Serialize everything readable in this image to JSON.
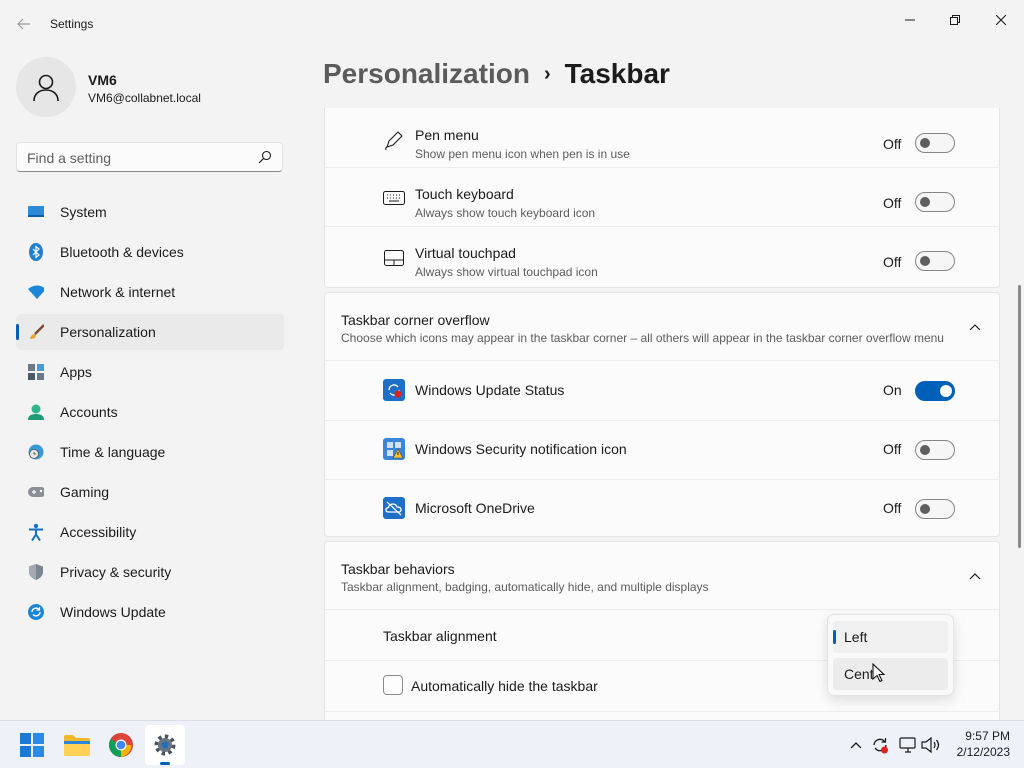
{
  "window": {
    "title": "Settings"
  },
  "user": {
    "name": "VM6",
    "email": "VM6@collabnet.local"
  },
  "search": {
    "placeholder": "Find a setting"
  },
  "sidebar": {
    "items": [
      {
        "label": "System",
        "icon": "system-icon"
      },
      {
        "label": "Bluetooth & devices",
        "icon": "bluetooth-icon"
      },
      {
        "label": "Network & internet",
        "icon": "wifi-icon"
      },
      {
        "label": "Personalization",
        "icon": "brush-icon",
        "active": true
      },
      {
        "label": "Apps",
        "icon": "apps-icon"
      },
      {
        "label": "Accounts",
        "icon": "accounts-icon"
      },
      {
        "label": "Time & language",
        "icon": "clock-globe-icon"
      },
      {
        "label": "Gaming",
        "icon": "gamepad-icon"
      },
      {
        "label": "Accessibility",
        "icon": "accessibility-icon"
      },
      {
        "label": "Privacy & security",
        "icon": "shield-icon"
      },
      {
        "label": "Windows Update",
        "icon": "update-icon"
      }
    ]
  },
  "breadcrumb": {
    "parent": "Personalization",
    "separator": "›",
    "current": "Taskbar"
  },
  "corner_icons": [
    {
      "title": "Pen menu",
      "subtitle": "Show pen menu icon when pen is in use",
      "state": "Off",
      "on": false,
      "icon": "pen-icon"
    },
    {
      "title": "Touch keyboard",
      "subtitle": "Always show touch keyboard icon",
      "state": "Off",
      "on": false,
      "icon": "keyboard-icon"
    },
    {
      "title": "Virtual touchpad",
      "subtitle": "Always show virtual touchpad icon",
      "state": "Off",
      "on": false,
      "icon": "touchpad-icon"
    }
  ],
  "overflow": {
    "title": "Taskbar corner overflow",
    "subtitle": "Choose which icons may appear in the taskbar corner – all others will appear in the taskbar corner overflow menu",
    "items": [
      {
        "title": "Windows Update Status",
        "state": "On",
        "on": true,
        "icon": "windows-update-status-icon"
      },
      {
        "title": "Windows Security notification icon",
        "state": "Off",
        "on": false,
        "icon": "windows-security-icon"
      },
      {
        "title": "Microsoft OneDrive",
        "state": "Off",
        "on": false,
        "icon": "onedrive-icon"
      }
    ]
  },
  "behaviors": {
    "title": "Taskbar behaviors",
    "subtitle": "Taskbar alignment, badging, automatically hide, and multiple displays",
    "alignment_label": "Taskbar alignment",
    "autohide_label": "Automatically hide the taskbar"
  },
  "alignment_dropdown": {
    "options": [
      "Left",
      "Center"
    ],
    "selected": "Left",
    "visible_options": [
      "Left",
      "Cent"
    ]
  },
  "clock": {
    "time": "9:57 PM",
    "date": "2/12/2023"
  },
  "colors": {
    "accent": "#005fb8",
    "background": "#f3f3f3",
    "card": "#fbfbfb"
  }
}
